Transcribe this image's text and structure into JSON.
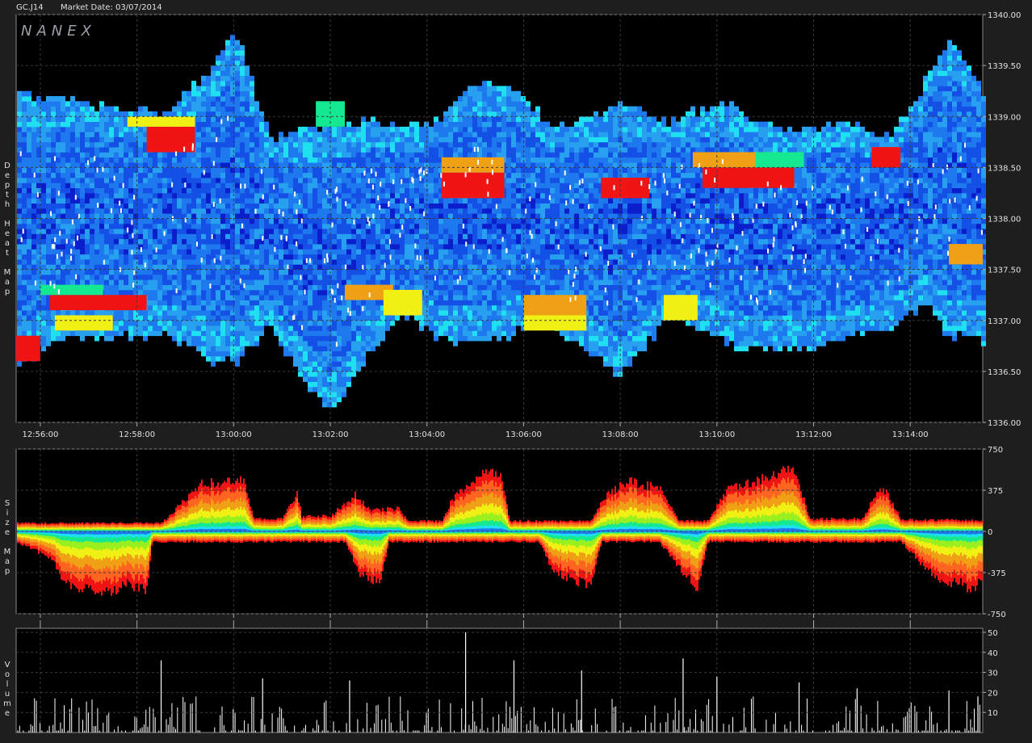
{
  "header": {
    "symbol": "GC.J14",
    "market_date": "Market Date: 03/07/2014"
  },
  "logo": "NANEX",
  "panels": {
    "depth_label": "Depth Heat Map",
    "size_label": "Size Map",
    "volume_label": "Volume"
  },
  "colors": {
    "background": "#000000",
    "frame": "#1e1e1e",
    "grid": "#3a3a3a",
    "heat_scale": [
      "#0a1ecc",
      "#1450e6",
      "#1e78ee",
      "#28a0f0",
      "#1ee0f0",
      "#14e890",
      "#9aef1e",
      "#f0f014",
      "#f0a014",
      "#ff6420",
      "#f01414"
    ]
  },
  "chart_data": [
    {
      "type": "heatmap",
      "title": "Depth Heat Map",
      "x_ticks": [
        "12:56:00",
        "12:58:00",
        "13:00:00",
        "13:02:00",
        "13:04:00",
        "13:06:00",
        "13:08:00",
        "13:10:00",
        "13:12:00",
        "13:14:00"
      ],
      "y_ticks": [
        "1340.00",
        "1339.50",
        "1339.00",
        "1338.50",
        "1338.00",
        "1337.50",
        "1337.00",
        "1336.50",
        "1336.00"
      ],
      "ylim": [
        1336.0,
        1340.0
      ],
      "x_range_minutes": [
        -0.5,
        19.5
      ],
      "band_center": [
        [
          -0.5,
          1337.9
        ],
        [
          0.5,
          1338.0
        ],
        [
          1.5,
          1337.95
        ],
        [
          2.5,
          1337.95
        ],
        [
          3.5,
          1338.05
        ],
        [
          4.0,
          1338.2
        ],
        [
          5.0,
          1337.75
        ],
        [
          6.0,
          1337.5
        ],
        [
          6.8,
          1337.85
        ],
        [
          7.5,
          1337.95
        ],
        [
          8.2,
          1337.9
        ],
        [
          9.0,
          1338.05
        ],
        [
          10.0,
          1338.05
        ],
        [
          11.0,
          1337.85
        ],
        [
          12.0,
          1337.8
        ],
        [
          13.0,
          1338.0
        ],
        [
          13.7,
          1338.0
        ],
        [
          14.2,
          1337.95
        ],
        [
          15.0,
          1337.8
        ],
        [
          16.0,
          1337.8
        ],
        [
          16.5,
          1337.9
        ],
        [
          17.5,
          1337.85
        ],
        [
          18.4,
          1338.3
        ],
        [
          19.0,
          1338.25
        ],
        [
          19.5,
          1338.0
        ]
      ],
      "band_halfwidth": [
        [
          -0.5,
          1.3
        ],
        [
          0.5,
          1.15
        ],
        [
          2.5,
          1.05
        ],
        [
          4.0,
          1.6
        ],
        [
          4.7,
          0.9
        ],
        [
          6.0,
          1.4
        ],
        [
          6.5,
          1.2
        ],
        [
          7.5,
          0.9
        ],
        [
          8.0,
          1.0
        ],
        [
          9.0,
          1.25
        ],
        [
          9.6,
          1.2
        ],
        [
          10.5,
          0.95
        ],
        [
          12.0,
          1.3
        ],
        [
          13.0,
          0.9
        ],
        [
          13.4,
          1.0
        ],
        [
          14.2,
          1.15
        ],
        [
          15.5,
          1.05
        ],
        [
          16.5,
          1.05
        ],
        [
          17.5,
          0.9
        ],
        [
          18.2,
          1.05
        ],
        [
          18.8,
          1.45
        ],
        [
          19.5,
          1.2
        ]
      ],
      "hot_zones": [
        {
          "x": [
            2.2,
            3.2
          ],
          "y": [
            1338.65,
            1338.9
          ],
          "level": "red"
        },
        {
          "x": [
            1.8,
            3.2
          ],
          "y": [
            1338.9,
            1339.0
          ],
          "level": "yellow"
        },
        {
          "x": [
            0.2,
            2.2
          ],
          "y": [
            1337.1,
            1337.25
          ],
          "level": "red"
        },
        {
          "x": [
            0.0,
            1.3
          ],
          "y": [
            1337.25,
            1337.35
          ],
          "level": "green"
        },
        {
          "x": [
            0.3,
            1.5
          ],
          "y": [
            1336.9,
            1337.05
          ],
          "level": "yellow"
        },
        {
          "x": [
            -0.5,
            0.0
          ],
          "y": [
            1336.6,
            1336.85
          ],
          "level": "red"
        },
        {
          "x": [
            8.3,
            9.6
          ],
          "y": [
            1338.2,
            1338.45
          ],
          "level": "red"
        },
        {
          "x": [
            8.3,
            9.6
          ],
          "y": [
            1338.45,
            1338.6
          ],
          "level": "orange"
        },
        {
          "x": [
            10.0,
            11.3
          ],
          "y": [
            1337.05,
            1337.25
          ],
          "level": "orange"
        },
        {
          "x": [
            10.0,
            11.3
          ],
          "y": [
            1336.9,
            1337.05
          ],
          "level": "yellow"
        },
        {
          "x": [
            13.7,
            15.6
          ],
          "y": [
            1338.3,
            1338.5
          ],
          "level": "red"
        },
        {
          "x": [
            13.5,
            15.3
          ],
          "y": [
            1338.5,
            1338.65
          ],
          "level": "orange"
        },
        {
          "x": [
            14.8,
            15.8
          ],
          "y": [
            1338.5,
            1338.65
          ],
          "level": "green"
        },
        {
          "x": [
            11.6,
            12.6
          ],
          "y": [
            1338.2,
            1338.4
          ],
          "level": "red"
        },
        {
          "x": [
            6.3,
            7.3
          ],
          "y": [
            1337.2,
            1337.35
          ],
          "level": "orange"
        },
        {
          "x": [
            7.1,
            7.9
          ],
          "y": [
            1337.05,
            1337.3
          ],
          "level": "yellow"
        },
        {
          "x": [
            12.9,
            13.6
          ],
          "y": [
            1337.0,
            1337.25
          ],
          "level": "yellow"
        },
        {
          "x": [
            18.8,
            19.5
          ],
          "y": [
            1337.55,
            1337.75
          ],
          "level": "orange"
        },
        {
          "x": [
            17.2,
            17.8
          ],
          "y": [
            1338.5,
            1338.7
          ],
          "level": "red"
        },
        {
          "x": [
            5.7,
            6.3
          ],
          "y": [
            1338.9,
            1339.15
          ],
          "level": "green"
        }
      ]
    },
    {
      "type": "area",
      "title": "Size Map",
      "x_ticks": [
        "12:56:00",
        "12:58:00",
        "13:00:00",
        "13:02:00",
        "13:04:00",
        "13:06:00",
        "13:08:00",
        "13:10:00",
        "13:12:00",
        "13:14:00"
      ],
      "y_ticks": [
        "750",
        "375",
        "0",
        "-375",
        "-750"
      ],
      "ylim": [
        -750,
        750
      ],
      "upper_envelope": [
        [
          -0.5,
          80
        ],
        [
          2.5,
          80
        ],
        [
          2.8,
          220
        ],
        [
          3.3,
          450
        ],
        [
          4.2,
          500
        ],
        [
          4.4,
          120
        ],
        [
          5.0,
          120
        ],
        [
          5.3,
          380
        ],
        [
          5.4,
          140
        ],
        [
          6.0,
          150
        ],
        [
          6.5,
          350
        ],
        [
          6.8,
          200
        ],
        [
          7.4,
          220
        ],
        [
          7.6,
          100
        ],
        [
          8.3,
          100
        ],
        [
          8.5,
          300
        ],
        [
          9.0,
          520
        ],
        [
          9.5,
          570
        ],
        [
          9.7,
          100
        ],
        [
          11.4,
          100
        ],
        [
          11.6,
          300
        ],
        [
          12.1,
          480
        ],
        [
          12.8,
          420
        ],
        [
          13.2,
          100
        ],
        [
          13.8,
          100
        ],
        [
          14.2,
          400
        ],
        [
          14.8,
          480
        ],
        [
          15.2,
          560
        ],
        [
          15.6,
          600
        ],
        [
          15.9,
          120
        ],
        [
          17.0,
          120
        ],
        [
          17.3,
          370
        ],
        [
          17.5,
          380
        ],
        [
          17.8,
          110
        ],
        [
          19.0,
          110
        ],
        [
          19.5,
          100
        ]
      ],
      "lower_envelope": [
        [
          -0.5,
          -100
        ],
        [
          0.2,
          -250
        ],
        [
          0.5,
          -480
        ],
        [
          1.2,
          -610
        ],
        [
          1.8,
          -510
        ],
        [
          2.2,
          -560
        ],
        [
          2.3,
          -100
        ],
        [
          6.3,
          -100
        ],
        [
          6.6,
          -400
        ],
        [
          7.0,
          -500
        ],
        [
          7.2,
          -100
        ],
        [
          10.3,
          -100
        ],
        [
          10.6,
          -380
        ],
        [
          11.1,
          -480
        ],
        [
          11.4,
          -510
        ],
        [
          11.6,
          -100
        ],
        [
          12.8,
          -100
        ],
        [
          13.3,
          -400
        ],
        [
          13.6,
          -550
        ],
        [
          13.8,
          -100
        ],
        [
          17.8,
          -100
        ],
        [
          18.2,
          -300
        ],
        [
          18.6,
          -480
        ],
        [
          19.0,
          -490
        ],
        [
          19.3,
          -580
        ],
        [
          19.5,
          -400
        ]
      ]
    },
    {
      "type": "bar",
      "title": "Volume",
      "x_ticks": [
        "12:56:00",
        "12:58:00",
        "13:00:00",
        "13:02:00",
        "13:04:00",
        "13:06:00",
        "13:08:00",
        "13:10:00",
        "13:12:00",
        "13:14:00"
      ],
      "y_ticks": [
        "50",
        "40",
        "30",
        "20",
        "10"
      ],
      "ylim": [
        0,
        52
      ],
      "spikes": [
        [
          2.5,
          36
        ],
        [
          4.6,
          27
        ],
        [
          6.4,
          26
        ],
        [
          8.8,
          50
        ],
        [
          9.8,
          36
        ],
        [
          11.2,
          31
        ],
        [
          13.3,
          37
        ],
        [
          14.0,
          28
        ],
        [
          15.7,
          25
        ],
        [
          16.9,
          22
        ],
        [
          18.8,
          21
        ],
        [
          19.4,
          18
        ]
      ],
      "typical_max": 18
    }
  ]
}
